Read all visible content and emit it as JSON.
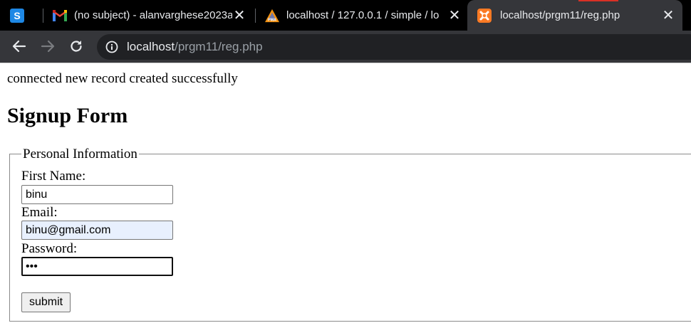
{
  "browser": {
    "tabs": [
      {
        "title": "",
        "icon": "site-s-icon"
      },
      {
        "title": "(no subject) - alanvarghese2023a",
        "icon": "gmail-icon"
      },
      {
        "title": "localhost / 127.0.0.1 / simple / lo",
        "icon": "phpmyadmin-icon"
      },
      {
        "title": "localhost/prgm11/reg.php",
        "icon": "xampp-icon",
        "active": true
      }
    ],
    "close_glyph": "✕",
    "address": {
      "host": "localhost",
      "path": "/prgm11/reg.php"
    },
    "colors": {
      "tabbar": "#000000",
      "toolbar": "#35363a",
      "omnibox": "#202124"
    }
  },
  "page": {
    "status_message": "connected new record created successfully",
    "heading": "Signup Form",
    "fieldset_legend": "Personal Information",
    "fields": {
      "first_name": {
        "label": "First Name:",
        "value": "binu"
      },
      "email": {
        "label": "Email:",
        "value": "binu@gmail.com"
      },
      "password": {
        "label": "Password:",
        "value": "•••"
      }
    },
    "submit_label": "submit"
  }
}
